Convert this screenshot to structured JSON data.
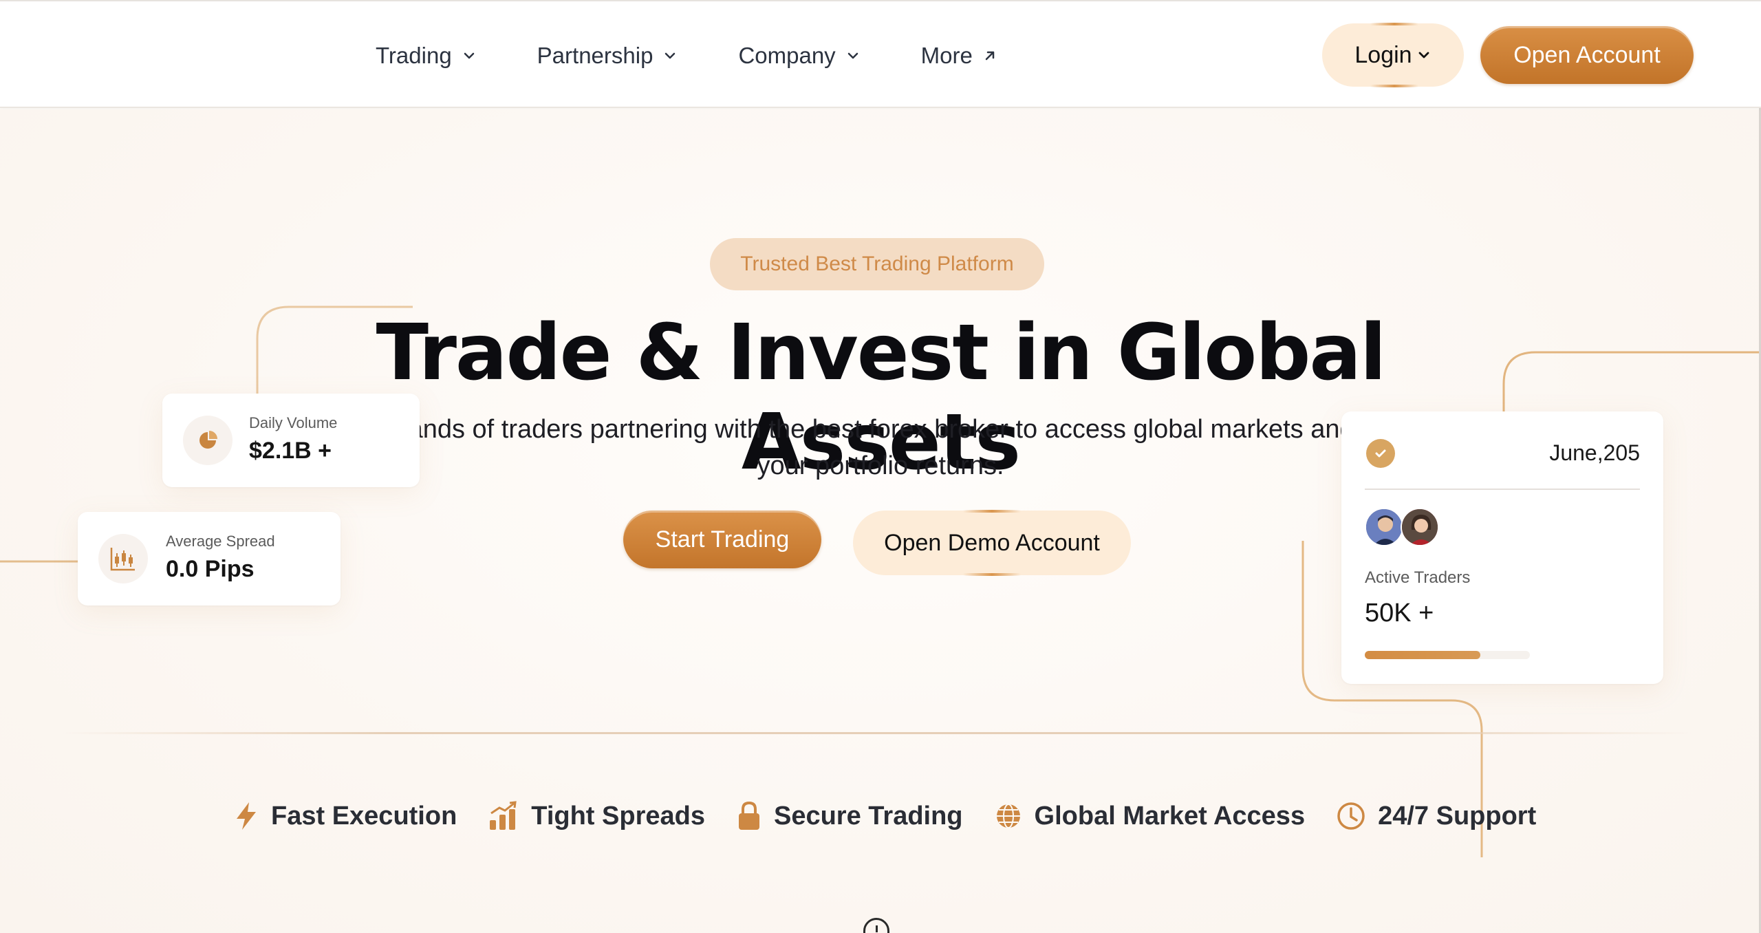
{
  "nav": {
    "links": [
      {
        "label": "Trading",
        "icon": "chevron-down-icon"
      },
      {
        "label": "Partnership",
        "icon": "chevron-down-icon"
      },
      {
        "label": "Company",
        "icon": "chevron-down-icon"
      },
      {
        "label": "More",
        "icon": "arrow-up-right-icon"
      }
    ],
    "login_label": "Login",
    "open_account_label": "Open Account"
  },
  "hero": {
    "badge": "Trusted Best Trading Platform",
    "headline": "Trade & Invest in Global Assets",
    "subtext": "Join thousands of traders partnering with the best forex broker to access global markets and maximize your portfolio returns.",
    "start_trading_label": "Start Trading",
    "demo_label": "Open Demo Account"
  },
  "stats": {
    "daily_volume": {
      "label": "Daily Volume",
      "value": "$2.1B +",
      "icon": "pie-chart-icon"
    },
    "average_spread": {
      "label": "Average Spread",
      "value": "0.0 Pips",
      "icon": "candlestick-chart-icon"
    },
    "active_traders": {
      "date": "June,205",
      "label": "Active Traders",
      "value": "50K +",
      "progress": 0.7
    }
  },
  "features": [
    {
      "label": "Fast Execution",
      "icon": "lightning-icon"
    },
    {
      "label": "Tight Spreads",
      "icon": "bar-chart-trend-icon"
    },
    {
      "label": "Secure Trading",
      "icon": "lock-icon"
    },
    {
      "label": "Global Market Access",
      "icon": "globe-icon"
    },
    {
      "label": "24/7 Support",
      "icon": "clock-icon"
    }
  ],
  "colors": {
    "accent": "#c97d32",
    "accent_light": "#fdecd8",
    "badge_bg": "#f4dcc4",
    "page_bg": "#fdfaf6"
  }
}
